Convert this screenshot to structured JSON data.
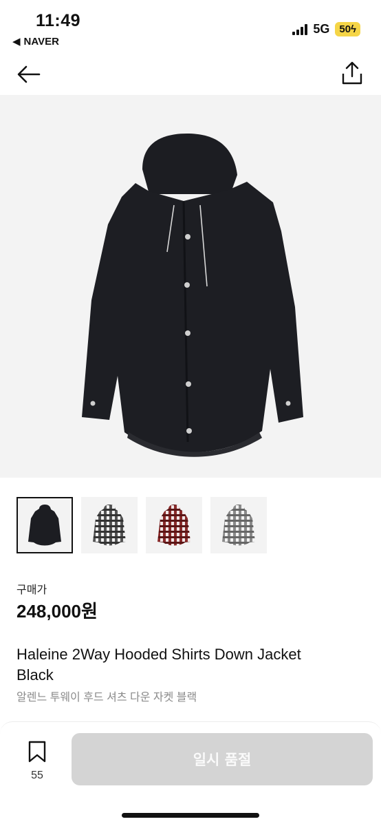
{
  "status_bar": {
    "time": "11:49",
    "back_app": "NAVER",
    "network": "5G",
    "battery": "50"
  },
  "product": {
    "price_label": "구매가",
    "price": "248,000원",
    "title": "Haleine 2Way Hooded Shirts Down Jacket Black",
    "subtitle": "알렌느 투웨이 후드 셔츠 다운 자켓 블랙",
    "thumbnails": [
      {
        "variant": "black",
        "color": "#1c1d22"
      },
      {
        "variant": "grey-check",
        "color": "#6b6b6b"
      },
      {
        "variant": "red-check",
        "color": "#8a2a2a"
      },
      {
        "variant": "light-grey-check",
        "color": "#9a9a9a"
      }
    ]
  },
  "bottom_bar": {
    "bookmark_count": "55",
    "soldout_label": "일시 품절"
  },
  "icons": {
    "back": "arrow-left-icon",
    "share": "share-icon",
    "bookmark": "bookmark-icon"
  }
}
